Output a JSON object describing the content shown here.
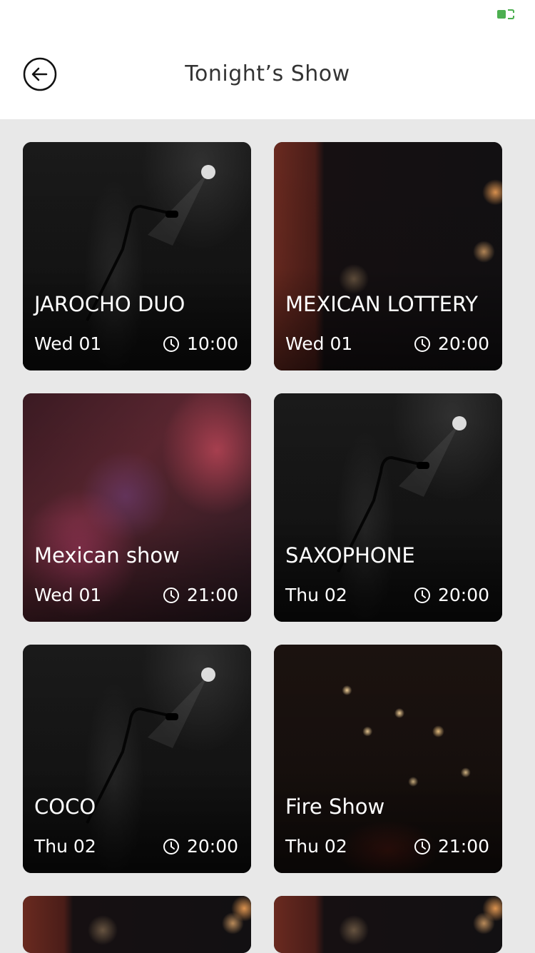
{
  "status_bar": {
    "battery_icon": "battery-icon",
    "battery_color": "#4caf50"
  },
  "header": {
    "title": "Tonight’s Show",
    "back_icon": "arrow-left-circle-icon"
  },
  "colors": {
    "header_bg": "#ffffff",
    "page_bg": "#e8e8e8",
    "title_text": "#333333",
    "card_text": "#ffffff"
  },
  "shows": [
    {
      "name": "JAROCHO DUO",
      "date": "Wed 01",
      "time": "10:00",
      "image": "stage-microphone"
    },
    {
      "name": "MEXICAN LOTTERY",
      "date": "Wed 01",
      "time": "20:00",
      "image": "lottery-lights"
    },
    {
      "name": "Mexican show",
      "date": "Wed 01",
      "time": "21:00",
      "image": "sugar-skull-masks"
    },
    {
      "name": "SAXOPHONE",
      "date": "Thu 02",
      "time": "20:00",
      "image": "stage-microphone"
    },
    {
      "name": "COCO",
      "date": "Thu 02",
      "time": "20:00",
      "image": "stage-microphone"
    },
    {
      "name": "Fire Show",
      "date": "Thu 02",
      "time": "21:00",
      "image": "fire-dancers"
    }
  ]
}
